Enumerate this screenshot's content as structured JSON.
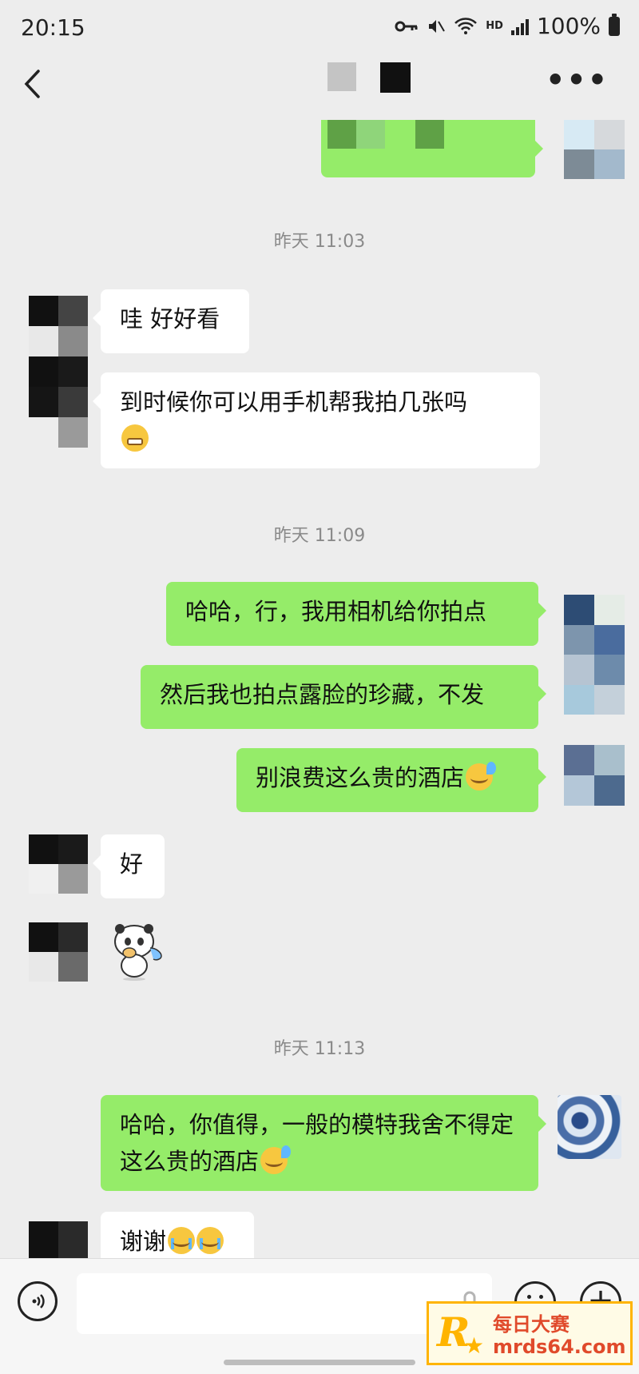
{
  "status_bar": {
    "time": "20:15",
    "hd_label": "HD",
    "battery": "100%"
  },
  "header": {
    "back_icon": "chevron-left-icon",
    "more_label": "•••"
  },
  "messages": {
    "time_1": "昨天 11:03",
    "msg_1": "哇 好好看",
    "msg_2": "到时候你可以用手机帮我拍几张吗",
    "time_2": "昨天 11:09",
    "msg_3": "哈哈，行，我用相机给你拍点",
    "msg_4": "然后我也拍点露脸的珍藏，不发",
    "msg_5": "别浪费这么贵的酒店",
    "msg_6": "好",
    "time_3": "昨天 11:13",
    "msg_7": "哈哈，你值得，一般的模特我舍不得定这么贵的酒店",
    "msg_8": "谢谢"
  },
  "input_bar": {
    "voice_icon": "voice-icon",
    "mic_icon": "mic-icon",
    "emoji_icon": "emoji-icon",
    "plus_icon": "plus-icon",
    "input_value": ""
  },
  "watermark": {
    "logo": "R",
    "title": "每日大赛",
    "url": "mrds64.com"
  },
  "colors": {
    "background": "#ededed",
    "sent_bubble": "#95ec69",
    "received_bubble": "#ffffff",
    "timestamp": "#8a8a8a"
  }
}
